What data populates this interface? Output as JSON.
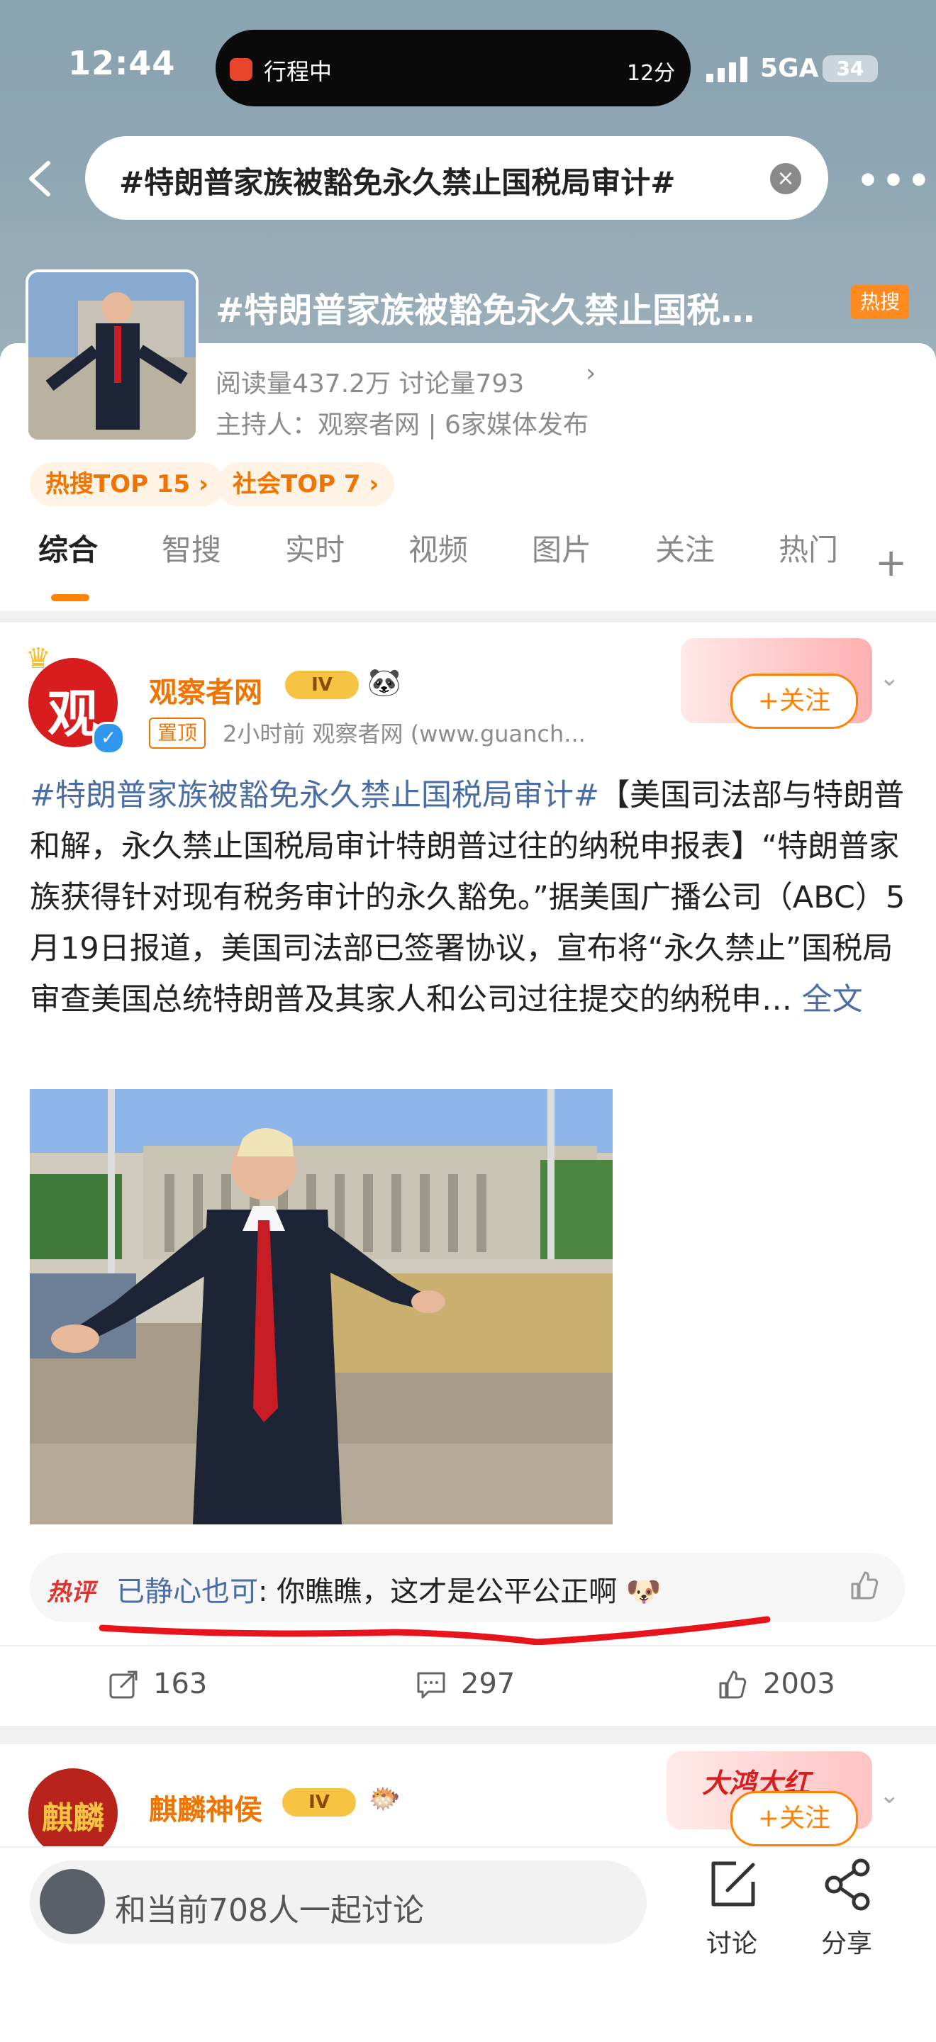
{
  "status_bar": {
    "time": "12:44",
    "activity_label": "行程中",
    "activity_time": "12分",
    "network": "5GA",
    "battery": "34"
  },
  "search": {
    "query": "#特朗普家族被豁免永久禁止国税局审计#"
  },
  "topic": {
    "title": "#特朗普家族被豁免永久禁止国税…",
    "hot_badge": "热搜",
    "stats": "阅读量437.2万  讨论量793",
    "host": "主持人：观察者网 | 6家媒体发布",
    "ranks": [
      "热搜TOP 15 ›",
      "社会TOP 7 ›"
    ]
  },
  "tabs": [
    "综合",
    "智搜",
    "实时",
    "视频",
    "图片",
    "关注",
    "热门"
  ],
  "post": {
    "avatar_char": "观",
    "author": "观察者网",
    "vip": "IV",
    "pin": "置顶",
    "meta": "2小时前  观察者网 (www.guanch...",
    "follow": "+关注",
    "hashtag": "#特朗普家族被豁免永久禁止国税局审计#",
    "body": "【美国司法部与特朗普和解，永久禁止国税局审计特朗普过往的纳税申报表】“特朗普家族获得针对现有税务审计的永久豁免。”据美国广播公司（ABC）5月19日报道，美国司法部已签署协议，宣布将“永久禁止”国税局审查美国总统特朗普及其家人和公司过往提交的纳税申…",
    "fulltext": "全文",
    "hot_comment_label": "热评",
    "hot_comment_user": "已静心也可",
    "hot_comment_text": ": 你瞧瞧，这才是公平公正啊",
    "reposts": "163",
    "comments": "297",
    "likes": "2003"
  },
  "post2": {
    "avatar_text": "麒麟",
    "author": "麒麟神侯",
    "vip": "IV",
    "deco_text": "大鸿大红",
    "follow": "+关注"
  },
  "bottom_bar": {
    "discuss_placeholder": "和当前708人一起讨论",
    "discuss_label": "讨论",
    "share_label": "分享"
  },
  "colors": {
    "accent": "#ff8200",
    "link": "#4a6ea3",
    "hot_red": "#e0312f"
  }
}
